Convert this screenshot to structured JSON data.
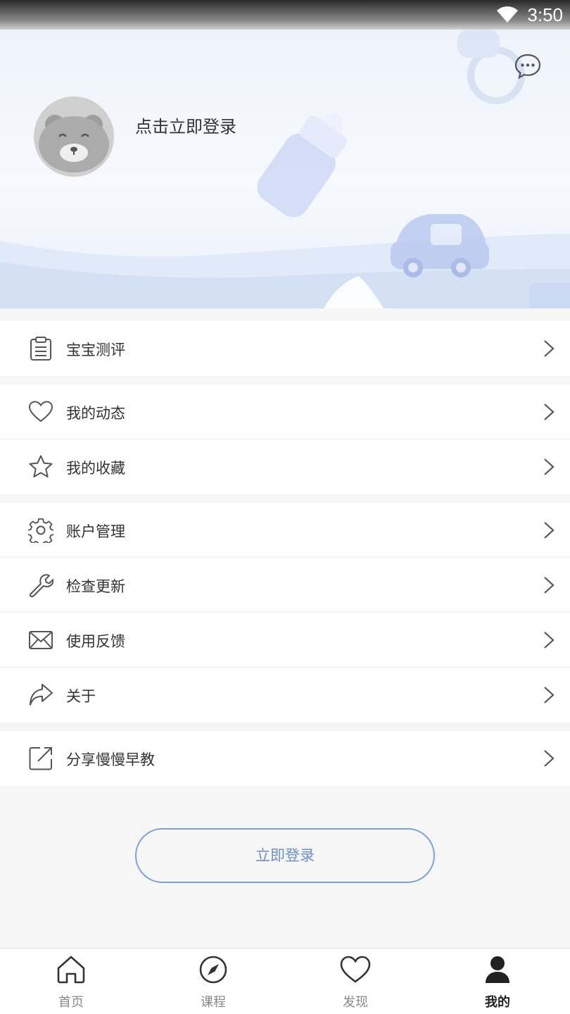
{
  "status_bar": {
    "time": "3:50"
  },
  "profile": {
    "login_prompt": "点击立即登录"
  },
  "menu": {
    "groups": [
      [
        {
          "label": "宝宝测评",
          "icon": "clipboard-icon"
        }
      ],
      [
        {
          "label": "我的动态",
          "icon": "heart-icon"
        },
        {
          "label": "我的收藏",
          "icon": "star-icon"
        }
      ],
      [
        {
          "label": "账户管理",
          "icon": "gear-icon"
        },
        {
          "label": "检查更新",
          "icon": "wrench-icon"
        },
        {
          "label": "使用反馈",
          "icon": "envelope-icon"
        },
        {
          "label": "关于",
          "icon": "share-arrow-icon"
        }
      ],
      [
        {
          "label": "分享慢慢早教",
          "icon": "external-link-icon"
        }
      ]
    ]
  },
  "login_button": {
    "label": "立即登录"
  },
  "tab_bar": {
    "tabs": [
      {
        "label": "首页",
        "icon": "home-icon"
      },
      {
        "label": "课程",
        "icon": "compass-icon"
      },
      {
        "label": "发现",
        "icon": "heart-icon"
      },
      {
        "label": "我的",
        "icon": "person-icon",
        "active": true
      }
    ]
  },
  "colors": {
    "accent": "#6d8fd0",
    "header_bg": "#eef3fb",
    "page_bg": "#f6f6f6"
  }
}
